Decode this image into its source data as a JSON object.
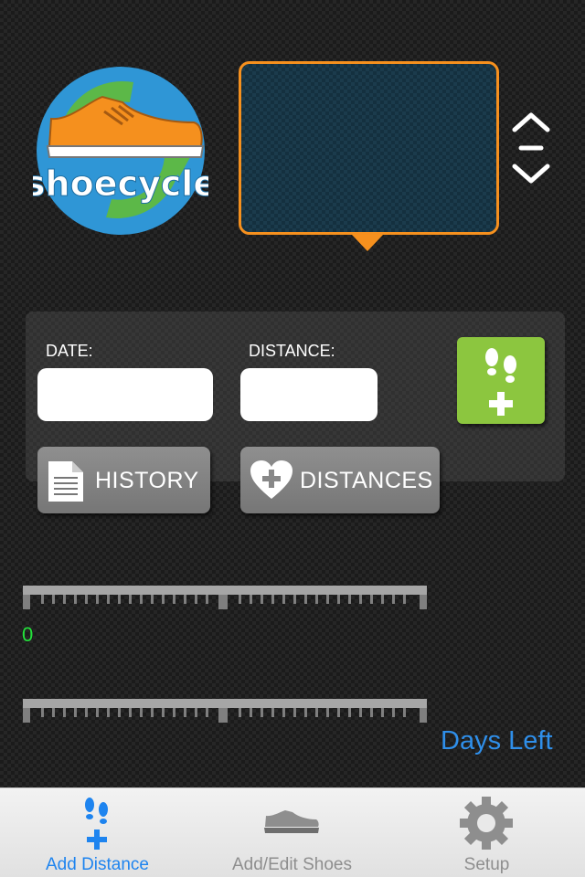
{
  "logo": {
    "text": "shoecycle"
  },
  "entry_form": {
    "date_label": "DATE:",
    "distance_label": "DISTANCE:",
    "date_value": "",
    "distance_value": ""
  },
  "buttons": {
    "history_label": "HISTORY",
    "distances_label": "DISTANCES"
  },
  "progress": {
    "distance_value": "0",
    "days_left_label": "Days Left"
  },
  "tab_bar": {
    "tabs": [
      {
        "label": "Add Distance",
        "icon": "footsteps-plus-icon",
        "selected": true
      },
      {
        "label": "Add/Edit Shoes",
        "icon": "shoe-icon",
        "selected": false
      },
      {
        "label": "Setup",
        "icon": "gear-icon",
        "selected": false
      }
    ]
  },
  "colors": {
    "accent_orange": "#f5901e",
    "add_green": "#8cc63f",
    "distance_green": "#23e23b",
    "days_blue": "#2f8fea",
    "tab_selected_blue": "#1e84ef"
  }
}
